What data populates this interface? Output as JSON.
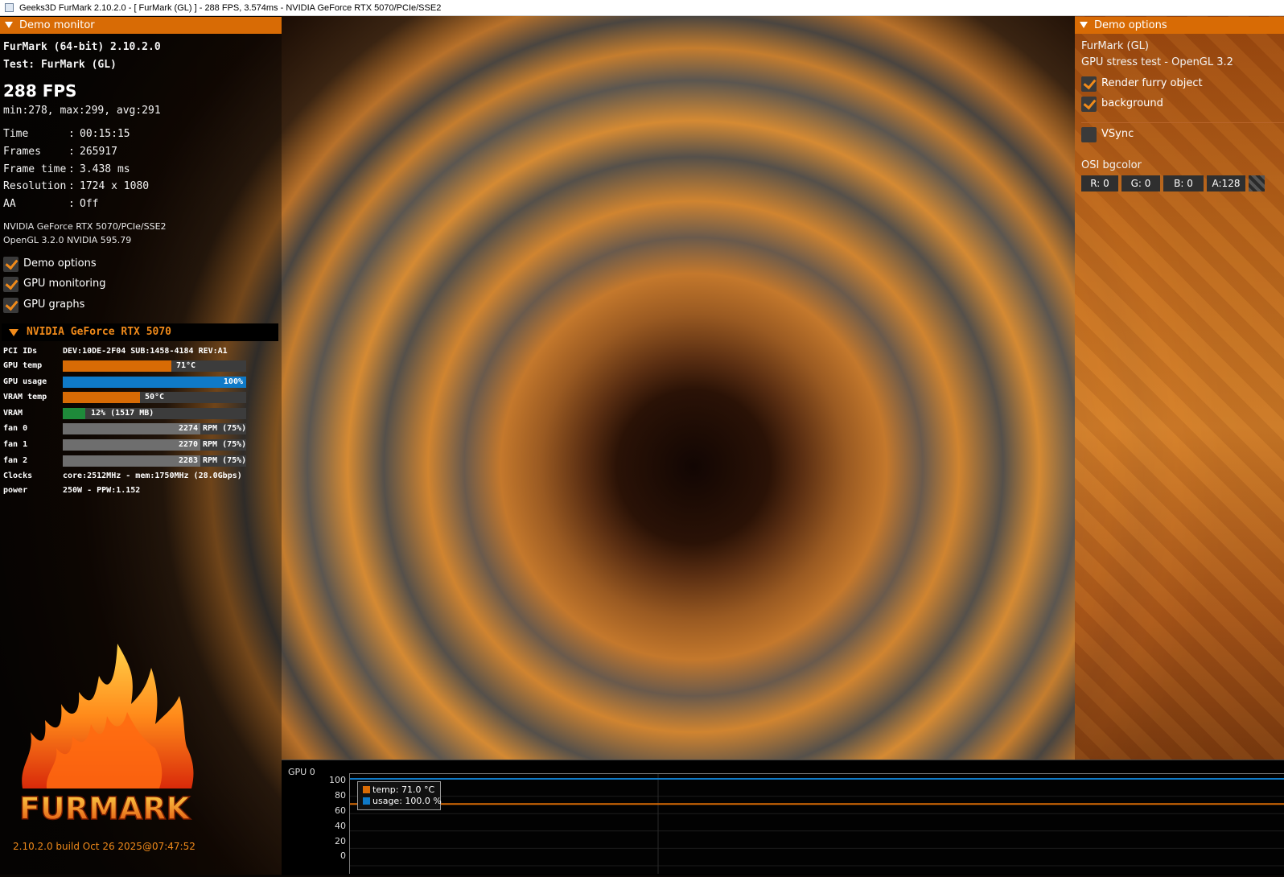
{
  "window": {
    "title": "Geeks3D FurMark 2.10.2.0 - [ FurMark (GL) ] - 288 FPS, 3.574ms - NVIDIA GeForce RTX 5070/PCIe/SSE2"
  },
  "demo_monitor": {
    "header": "Demo monitor",
    "app_line": "FurMark (64-bit) 2.10.2.0",
    "test_line": "Test: FurMark (GL)",
    "fps": "288 FPS",
    "fps_stats": "min:278, max:299, avg:291",
    "stats": [
      {
        "label": "Time",
        "value": "00:15:15"
      },
      {
        "label": "Frames",
        "value": "265917"
      },
      {
        "label": "Frame time",
        "value": "3.438 ms"
      },
      {
        "label": "Resolution",
        "value": "1724 x 1080"
      },
      {
        "label": "AA",
        "value": "Off"
      }
    ],
    "renderer": "NVIDIA GeForce RTX 5070/PCIe/SSE2",
    "gl_version": "OpenGL 3.2.0 NVIDIA 595.79",
    "checkboxes": [
      {
        "label": "Demo options",
        "checked": true
      },
      {
        "label": "GPU monitoring",
        "checked": true
      },
      {
        "label": "GPU graphs",
        "checked": true
      }
    ]
  },
  "gpu_monitor": {
    "name": "NVIDIA GeForce RTX 5070",
    "pci_label": "PCI IDs",
    "pci_value": "DEV:10DE-2F04 SUB:1458-4184 REV:A1",
    "bars": [
      {
        "label": "GPU temp",
        "text": "71°C",
        "fraction": 0.59,
        "color": "#d86b05"
      },
      {
        "label": "GPU usage",
        "text": "100%",
        "fraction": 1.0,
        "color": "#0f7ac8"
      },
      {
        "label": "VRAM temp",
        "text": "50°C",
        "fraction": 0.42,
        "color": "#d86b05"
      },
      {
        "label": "VRAM",
        "text": "12% (1517 MB)",
        "fraction": 0.12,
        "color": "#1e8a3a"
      },
      {
        "label": "fan 0",
        "text_num": "2274",
        "text_rest": "RPM (75%)",
        "fraction": 0.75,
        "color": "#6e6e6e"
      },
      {
        "label": "fan 1",
        "text_num": "2270",
        "text_rest": "RPM (75%)",
        "fraction": 0.75,
        "color": "#6e6e6e"
      },
      {
        "label": "fan 2",
        "text_num": "2283",
        "text_rest": "RPM (75%)",
        "fraction": 0.75,
        "color": "#6e6e6e"
      }
    ],
    "clocks_label": "Clocks",
    "clocks_value": "core:2512MHz - mem:1750MHz (28.0Gbps)",
    "power_label": "power",
    "power_value": "250W - PPW:1.152"
  },
  "logo": {
    "text": "FURMARK",
    "build": "2.10.2.0 build Oct 26 2025@07:47:52"
  },
  "demo_options": {
    "header": "Demo options",
    "demo_name": "FurMark (GL)",
    "demo_desc": "GPU stress test - OpenGL 3.2",
    "checkboxes": [
      {
        "label": "Render furry object",
        "checked": true
      },
      {
        "label": "background",
        "checked": true
      },
      {
        "label": "VSync",
        "checked": false
      }
    ],
    "bgcolor_label": "OSI bgcolor",
    "bgcolor": {
      "r": "R: 0",
      "g": "G: 0",
      "b": "B: 0",
      "a": "A:128"
    }
  },
  "graph": {
    "title": "GPU 0",
    "y_ticks": [
      "100",
      "80",
      "60",
      "40",
      "20",
      "0"
    ],
    "legend": [
      {
        "label": "temp: 71.0 °C",
        "color": "#d86b05"
      },
      {
        "label": "usage: 100.0 %",
        "color": "#0f7ac8"
      }
    ],
    "chart_data": {
      "type": "line",
      "ylim": [
        0,
        100
      ],
      "series": [
        {
          "name": "temp",
          "values": [
            71,
            71,
            71,
            71,
            71,
            71,
            71,
            71,
            71,
            71
          ]
        },
        {
          "name": "usage",
          "values": [
            100,
            100,
            100,
            100,
            100,
            100,
            100,
            100,
            100,
            100
          ]
        }
      ]
    }
  }
}
